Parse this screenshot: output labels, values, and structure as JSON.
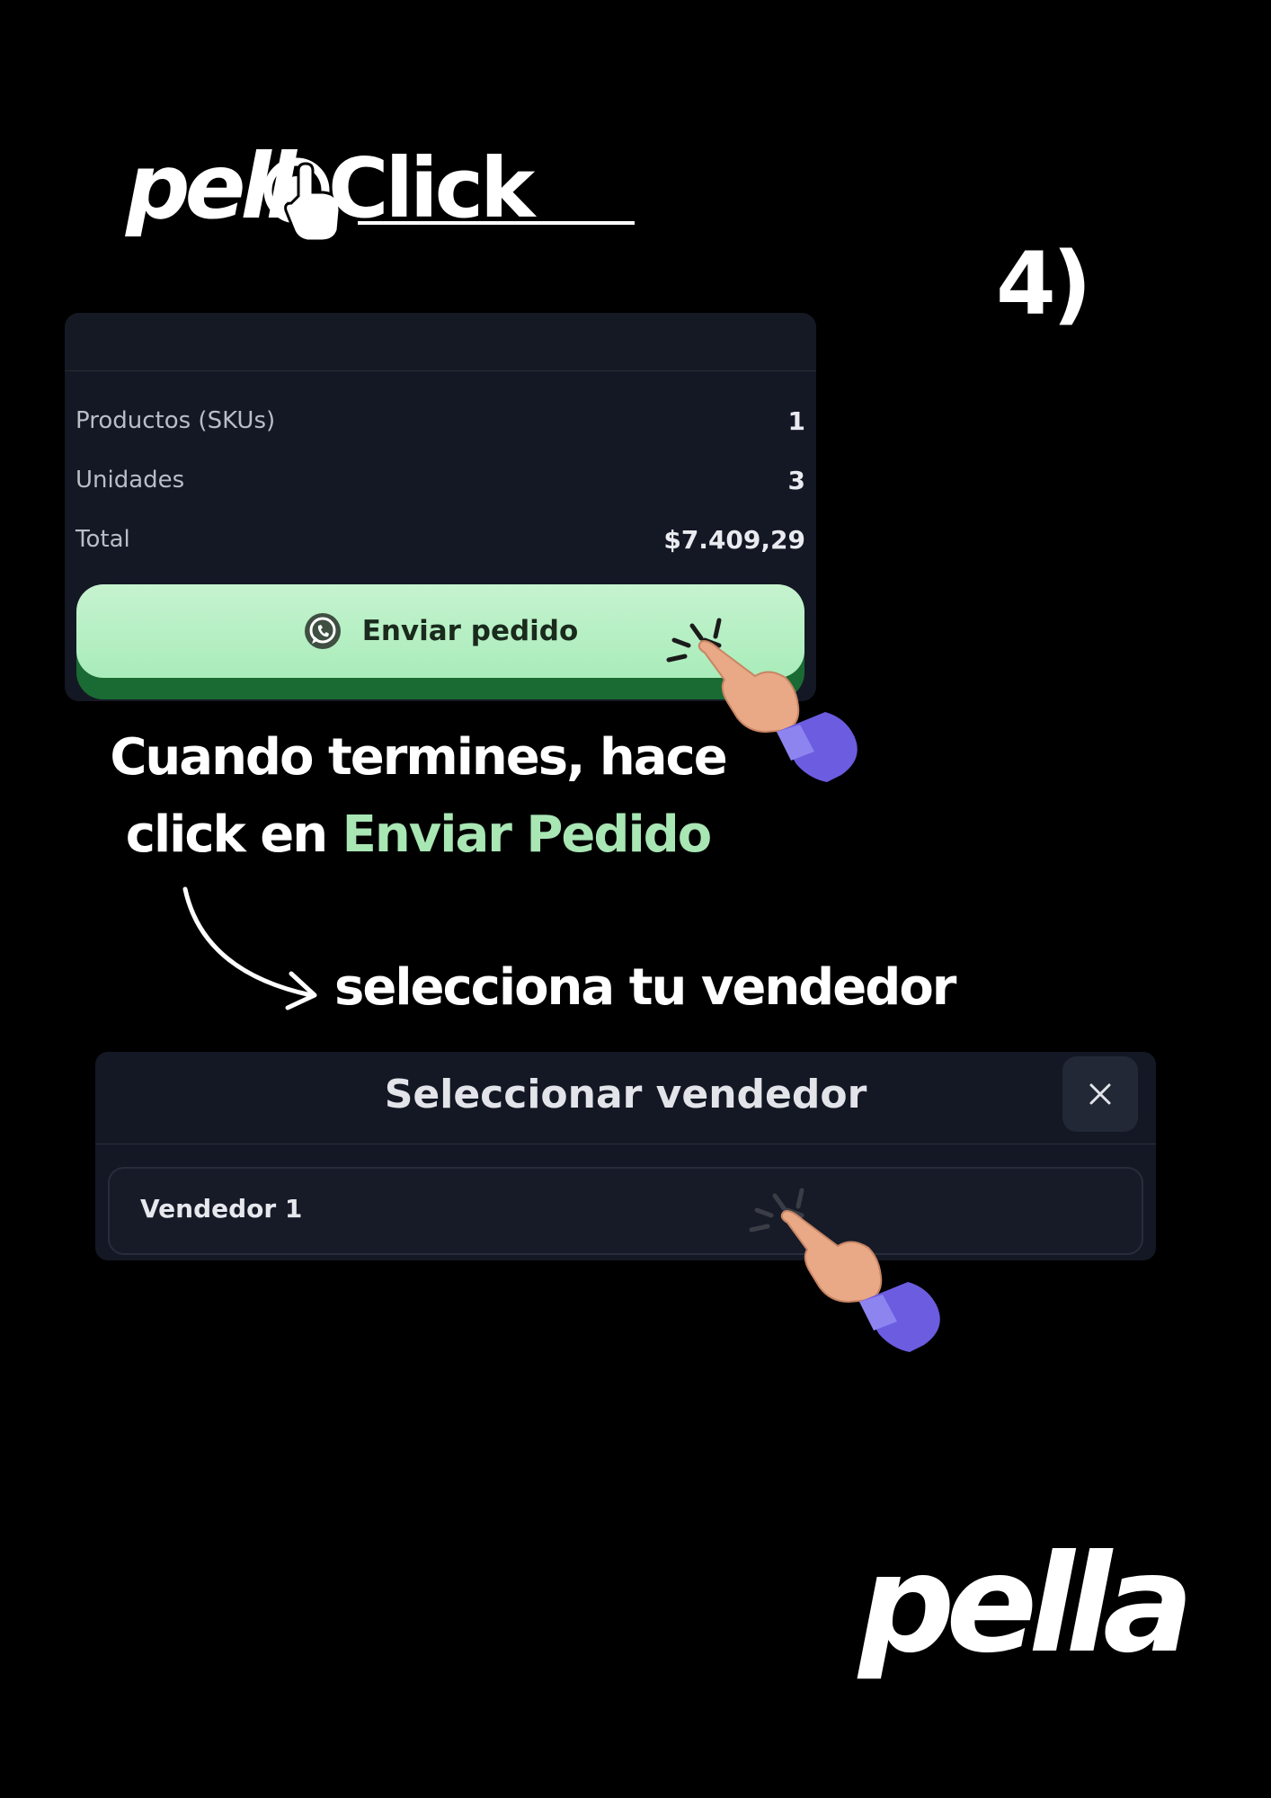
{
  "branding": {
    "top_logo_left": "pell",
    "top_logo_right": "Click",
    "bottom_logo": "pella"
  },
  "step": {
    "number": "4)"
  },
  "summary": {
    "rows": [
      {
        "label": "Productos (SKUs)",
        "value": "1"
      },
      {
        "label": "Unidades",
        "value": "3"
      },
      {
        "label": "Total",
        "value": "$7.409,29"
      }
    ],
    "send_button_label": "Enviar pedido",
    "send_button_icon": "whatsapp-icon",
    "button_color": "#b9f0c6"
  },
  "instruction": {
    "line1": "Cuando termines, hace",
    "line2_prefix": "click en ",
    "line2_highlight": "Enviar Pedido",
    "highlight_color": "#a8e6b4"
  },
  "select_hint": "selecciona tu vendedor",
  "seller_modal": {
    "title": "Seleccionar vendedor",
    "close_icon": "close-icon",
    "items": [
      {
        "label": "Vendedor 1"
      }
    ]
  }
}
